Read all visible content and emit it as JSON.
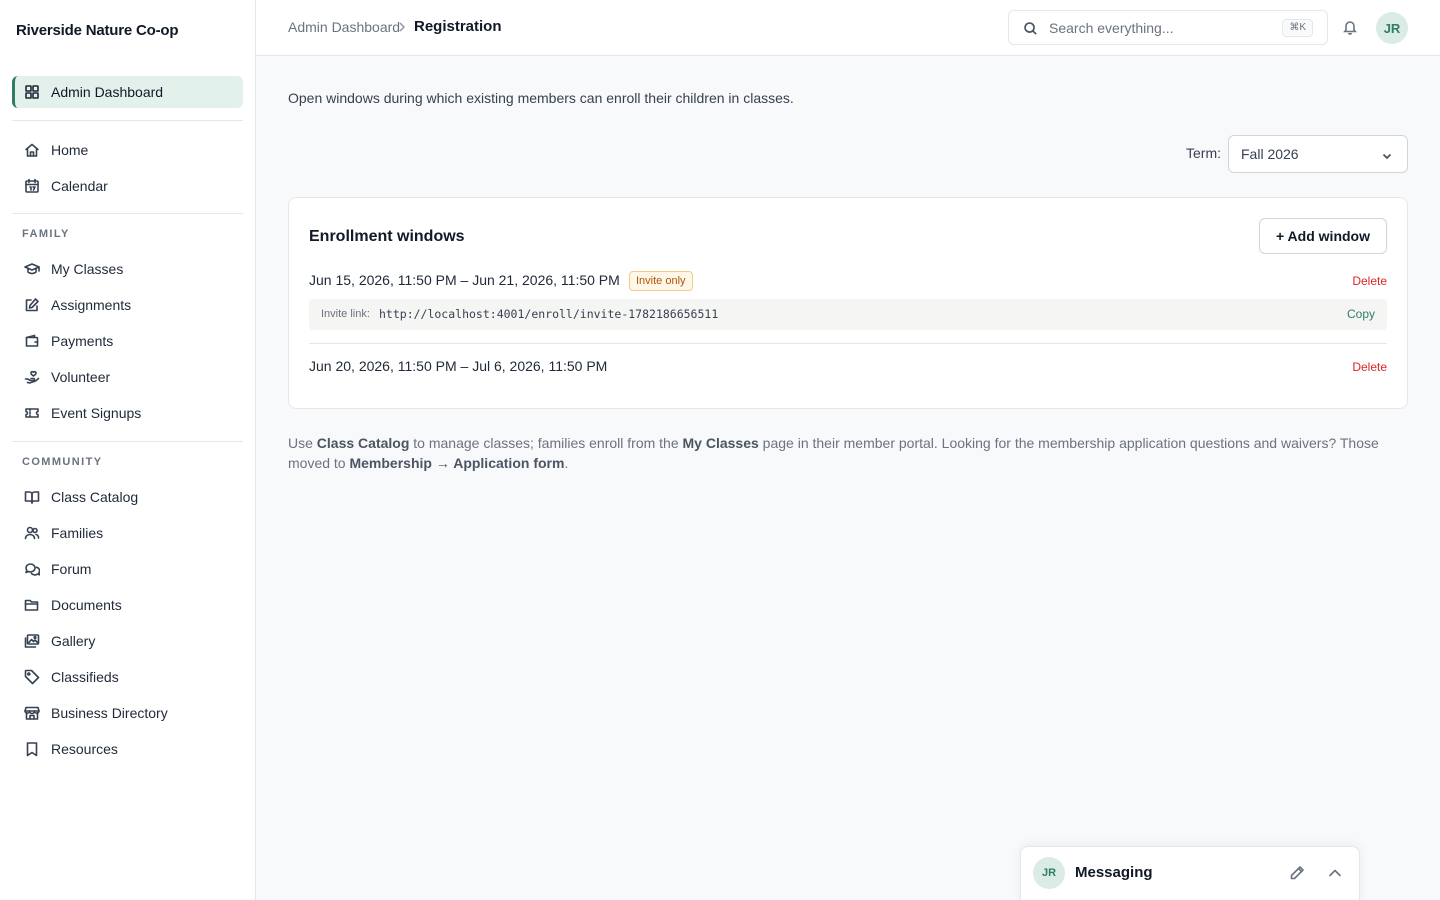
{
  "sidebar": {
    "brand": "Riverside Nature Co-op",
    "top_items": [
      {
        "label": "Admin Dashboard",
        "icon": "grid-icon",
        "active": true
      }
    ],
    "main_items": [
      {
        "label": "Home",
        "icon": "home-icon"
      },
      {
        "label": "Calendar",
        "icon": "calendar-icon"
      }
    ],
    "family_label": "FAMILY",
    "family_items": [
      {
        "label": "My Classes",
        "icon": "graduation-cap-icon"
      },
      {
        "label": "Assignments",
        "icon": "edit-icon"
      },
      {
        "label": "Payments",
        "icon": "wallet-icon"
      },
      {
        "label": "Volunteer",
        "icon": "hand-heart-icon"
      },
      {
        "label": "Event Signups",
        "icon": "ticket-icon"
      }
    ],
    "community_label": "COMMUNITY",
    "community_items": [
      {
        "label": "Class Catalog",
        "icon": "book-open-icon"
      },
      {
        "label": "Families",
        "icon": "users-icon"
      },
      {
        "label": "Forum",
        "icon": "chat-icon"
      },
      {
        "label": "Documents",
        "icon": "folder-icon"
      },
      {
        "label": "Gallery",
        "icon": "images-icon"
      },
      {
        "label": "Classifieds",
        "icon": "tag-icon"
      },
      {
        "label": "Business Directory",
        "icon": "store-icon"
      },
      {
        "label": "Resources",
        "icon": "bookmark-icon"
      }
    ]
  },
  "header": {
    "breadcrumb_parent": "Admin Dashboard",
    "breadcrumb_current": "Registration",
    "search_placeholder": "Search everything...",
    "search_shortcut": "⌘K",
    "avatar_initials": "JR"
  },
  "main": {
    "intro": "Open windows during which existing members can enroll their children in classes.",
    "term_label": "Term:",
    "term_value": "Fall 2026",
    "card_title": "Enrollment windows",
    "add_button": "+ Add window",
    "windows": [
      {
        "range": "Jun 15, 2026, 11:50 PM – Jun 21, 2026, 11:50 PM",
        "badge": "Invite only",
        "delete_label": "Delete",
        "invite_label": "Invite link:",
        "invite_url": "http://localhost:4001/enroll/invite-1782186656511",
        "copy_label": "Copy"
      },
      {
        "range": "Jun 20, 2026, 11:50 PM – Jul 6, 2026, 11:50 PM",
        "delete_label": "Delete"
      }
    ],
    "footnote": {
      "t1": "Use ",
      "b1": "Class Catalog",
      "t2": " to manage classes; families enroll from the ",
      "b2": "My Classes",
      "t3": " page in their member portal. Looking for the membership application questions and waivers? Those moved to ",
      "b3": "Membership → Application form",
      "t4": "."
    }
  },
  "messaging": {
    "avatar_initials": "JR",
    "title": "Messaging"
  },
  "colors": {
    "accent": "#2f7d66",
    "active_bg": "#e3f1ec",
    "danger": "#dc2626",
    "badge_text": "#b45309",
    "badge_bg": "#fef6e7"
  }
}
